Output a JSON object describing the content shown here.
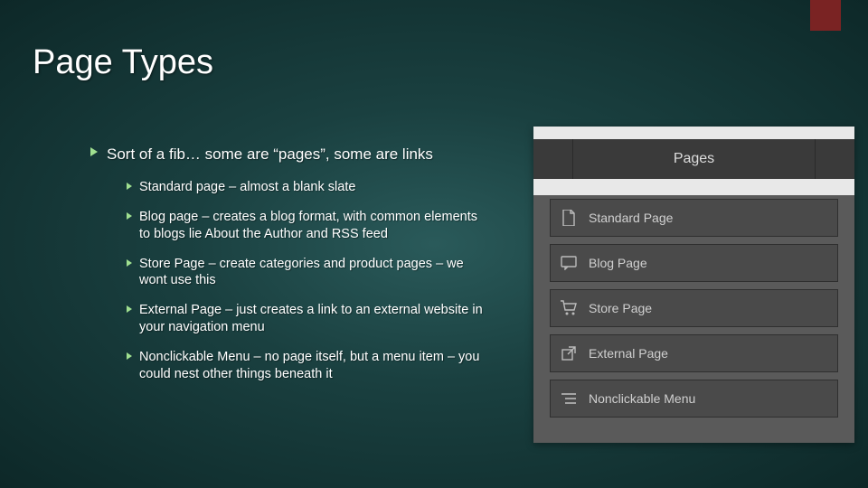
{
  "title": "Page Types",
  "main": {
    "intro": "Sort of a fib… some are “pages”, some are links",
    "items": [
      "Standard page – almost a blank slate",
      "Blog page – creates a blog format, with common elements to blogs lie About the Author and RSS feed",
      "Store Page – create categories and product pages – we wont use this",
      "External Page – just creates a link to an external website in your navigation menu",
      "Nonclickable Menu – no page itself, but a menu item – you could nest other things beneath it"
    ]
  },
  "panel": {
    "header": "Pages",
    "items": [
      {
        "icon": "file",
        "label": "Standard Page"
      },
      {
        "icon": "chat",
        "label": "Blog Page"
      },
      {
        "icon": "cart",
        "label": "Store Page"
      },
      {
        "icon": "external",
        "label": "External Page"
      },
      {
        "icon": "list",
        "label": "Nonclickable Menu"
      }
    ]
  }
}
